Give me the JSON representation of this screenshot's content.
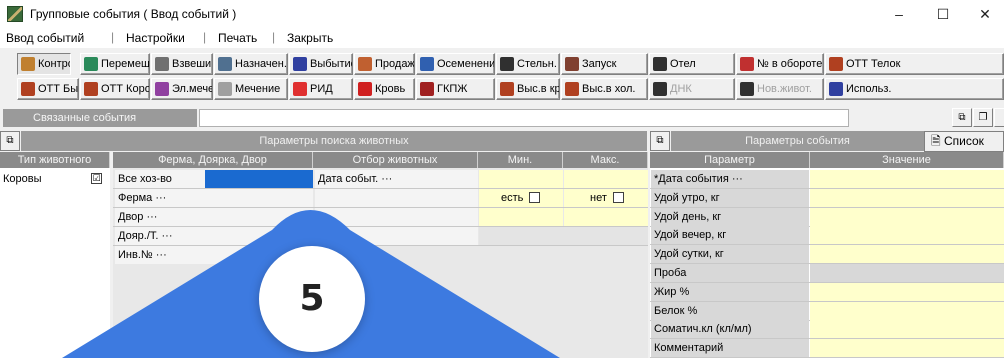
{
  "window": {
    "title": "Групповые события ( Ввод событий )",
    "minimize": "–",
    "maximize": "☐",
    "close": "✕"
  },
  "menu": {
    "items": [
      "Ввод событий",
      "Настройки",
      "Печать",
      "Закрыть"
    ],
    "separator": "|"
  },
  "toolbar_row1": [
    {
      "label": "Контроль",
      "icon": "control-icon",
      "color": "#c08030"
    },
    {
      "label": "Перемещ.",
      "icon": "move-icon",
      "color": "#2a8a5a"
    },
    {
      "label": "Взвешивание",
      "icon": "scales-icon",
      "color": "#707070"
    },
    {
      "label": "Назначен.",
      "icon": "assign-icon",
      "color": "#507090"
    },
    {
      "label": "Выбытие",
      "icon": "checkbox-icon",
      "color": "#3040a0"
    },
    {
      "label": "Продажа",
      "icon": "sale-icon",
      "color": "#c06030"
    },
    {
      "label": "Осеменение",
      "icon": "insemination-icon",
      "color": "#3060b0"
    },
    {
      "label": "Стельн.",
      "icon": "pregnancy-icon",
      "color": "#303030"
    },
    {
      "label": "Запуск",
      "icon": "launch-icon",
      "color": "#804030"
    },
    {
      "label": "Отел",
      "icon": "calving-icon",
      "color": "#303030"
    },
    {
      "label": "№ в обороте",
      "icon": "number-icon",
      "color": "#c03030"
    },
    {
      "label": "ОТТ Телок",
      "icon": "heifer-icon",
      "color": "#b04020"
    }
  ],
  "toolbar_row2": [
    {
      "label": "ОТТ Бычков",
      "icon": "bull-icon",
      "color": "#b04020"
    },
    {
      "label": "ОТТ Коров",
      "icon": "cow-icon",
      "color": "#b04020"
    },
    {
      "label": "Эл.мечен.",
      "icon": "electronic-tag-icon",
      "color": "#9040a0"
    },
    {
      "label": "Мечение",
      "icon": "tagging-icon",
      "color": "#a0a0a0"
    },
    {
      "label": "РИД",
      "icon": "rid-drop-icon",
      "color": "#e03030"
    },
    {
      "label": "Кровь",
      "icon": "blood-drop-icon",
      "color": "#d02020"
    },
    {
      "label": "ГКПЖ",
      "icon": "gkpzh-icon",
      "color": "#a02020"
    },
    {
      "label": "Выс.в кр.",
      "icon": "cull-herd-icon",
      "color": "#b04020"
    },
    {
      "label": "Выс.в хол.",
      "icon": "cull-cold-icon",
      "color": "#b04020"
    },
    {
      "label": "ДНК",
      "icon": "dna-icon",
      "color": "#303030",
      "disabled": true
    },
    {
      "label": "Нов.живот.",
      "icon": "new-animal-icon",
      "color": "#303030",
      "disabled": true
    },
    {
      "label": "Использ.",
      "icon": "usage-icon",
      "color": "#3040a0"
    }
  ],
  "linked_events": {
    "label": "Связанные события"
  },
  "left_panel": {
    "title": "Параметры поиска животных",
    "columns": {
      "animal_type": "Тип животного",
      "farm": "Ферма, Доярка, Двор",
      "selection": "Отбор животных",
      "min": "Мин.",
      "max": "Макс."
    },
    "animal_types": [
      {
        "name": "Коровы",
        "checked": "☑"
      }
    ],
    "farm_rows": [
      "Все хоз-во",
      "Ферма ···",
      "Двор ···",
      "Дояр./Т. ···",
      "Инв.№ ···"
    ],
    "selection_rows": [
      "Дата событ. ···",
      "",
      "",
      "",
      ""
    ],
    "exists_label": "есть",
    "not_exists_label": "нет"
  },
  "right_panel": {
    "title": "Параметры события",
    "list_button": "Список",
    "columns": {
      "param": "Параметр",
      "value": "Значение"
    },
    "params": [
      "*Дата события ···",
      "Удой утро, кг",
      "Удой день, кг",
      "Удой вечер, кг",
      "Удой сутки, кг",
      "Проба",
      "Жир %",
      "Белок %",
      "Соматич.кл (кл/мл)",
      "Комментарий"
    ]
  },
  "overlay": {
    "badge_number": "5",
    "triangle_color": "#3d7ae0"
  }
}
